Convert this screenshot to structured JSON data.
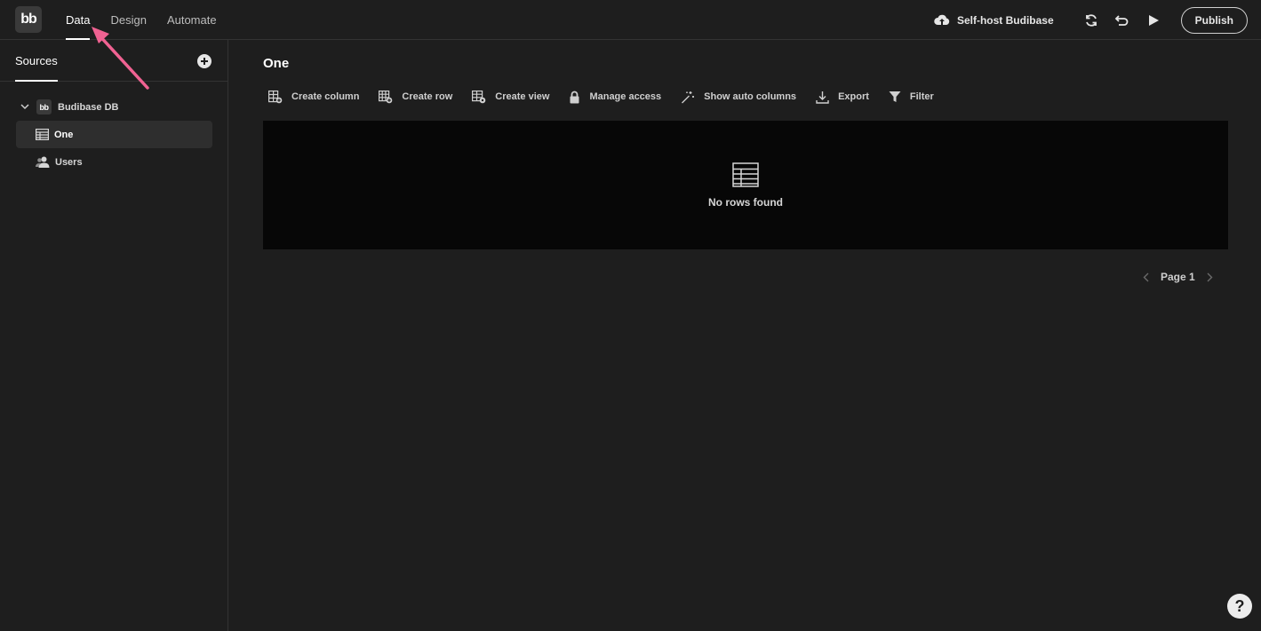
{
  "app": {
    "logo_text": "bb"
  },
  "topnav": {
    "tabs": [
      "Data",
      "Design",
      "Automate"
    ],
    "active": "Data"
  },
  "top_right": {
    "self_host_label": "Self-host Budibase",
    "publish_label": "Publish"
  },
  "sidebar": {
    "tab_label": "Sources",
    "datasource": {
      "name": "Budibase DB",
      "logo_text": "bb"
    },
    "tables": [
      {
        "label": "One",
        "selected": true
      },
      {
        "label": "Users",
        "selected": false
      }
    ]
  },
  "main": {
    "title": "One",
    "toolbar": [
      {
        "label": "Create column",
        "icon": "create-column-icon"
      },
      {
        "label": "Create row",
        "icon": "create-row-icon"
      },
      {
        "label": "Create view",
        "icon": "create-view-icon"
      },
      {
        "label": "Manage access",
        "icon": "lock-icon"
      },
      {
        "label": "Show auto columns",
        "icon": "magic-wand-icon"
      },
      {
        "label": "Export",
        "icon": "download-icon"
      },
      {
        "label": "Filter",
        "icon": "filter-icon"
      }
    ],
    "empty_message": "No rows found",
    "pager": {
      "label": "Page 1"
    }
  },
  "help": {
    "label": "?"
  },
  "colors": {
    "background": "#1e1e1e",
    "grid": "#070707",
    "annotation": "#f06292"
  }
}
